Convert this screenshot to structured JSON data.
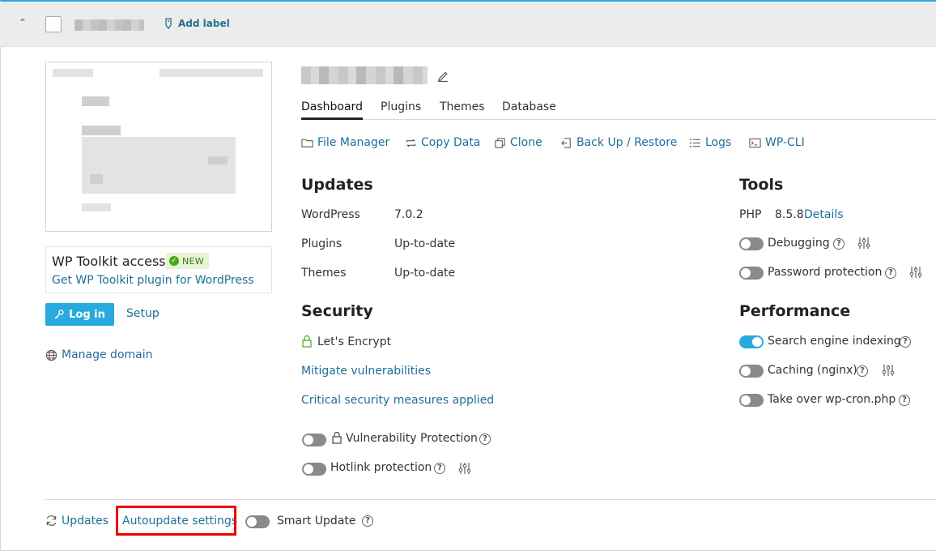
{
  "header": {
    "collapse_icon": "chevron-up-icon",
    "add_label": "Add label"
  },
  "left": {
    "access_title": "WP Toolkit access",
    "new_badge": "NEW",
    "access_link": "Get WP Toolkit plugin for WordPress",
    "login_label": "Log in",
    "setup_label": "Setup",
    "manage_domain": "Manage domain"
  },
  "tabs": [
    "Dashboard",
    "Plugins",
    "Themes",
    "Database"
  ],
  "active_tab": "Dashboard",
  "tool_links": [
    "File Manager",
    "Copy Data",
    "Clone",
    "Back Up / Restore",
    "Logs",
    "WP-CLI"
  ],
  "updates": {
    "title": "Updates",
    "rows": [
      {
        "label": "WordPress",
        "value": "7.0.2"
      },
      {
        "label": "Plugins",
        "value": "Up-to-date"
      },
      {
        "label": "Themes",
        "value": "Up-to-date"
      }
    ]
  },
  "security": {
    "title": "Security",
    "ssl": "Let's Encrypt",
    "mitigate": "Mitigate vulnerabilities",
    "critical": "Critical security measures applied",
    "vuln_protection": "Vulnerability Protection",
    "hotlink": "Hotlink protection"
  },
  "tools": {
    "title": "Tools",
    "php_label": "PHP",
    "php_version": "8.5.8",
    "php_details": "Details",
    "debugging": "Debugging",
    "password_protection": "Password protection"
  },
  "performance": {
    "title": "Performance",
    "search_indexing": "Search engine indexing",
    "caching": "Caching (nginx)",
    "wpcron": "Take over wp-cron.php"
  },
  "footer": {
    "updates": "Updates",
    "autoupdate": "Autoupdate settings",
    "smart_update": "Smart Update"
  },
  "colors": {
    "accent": "#28aade",
    "link": "#1f6f9a",
    "highlight": "#e00000",
    "toggle_off": "#8a8a8a"
  }
}
